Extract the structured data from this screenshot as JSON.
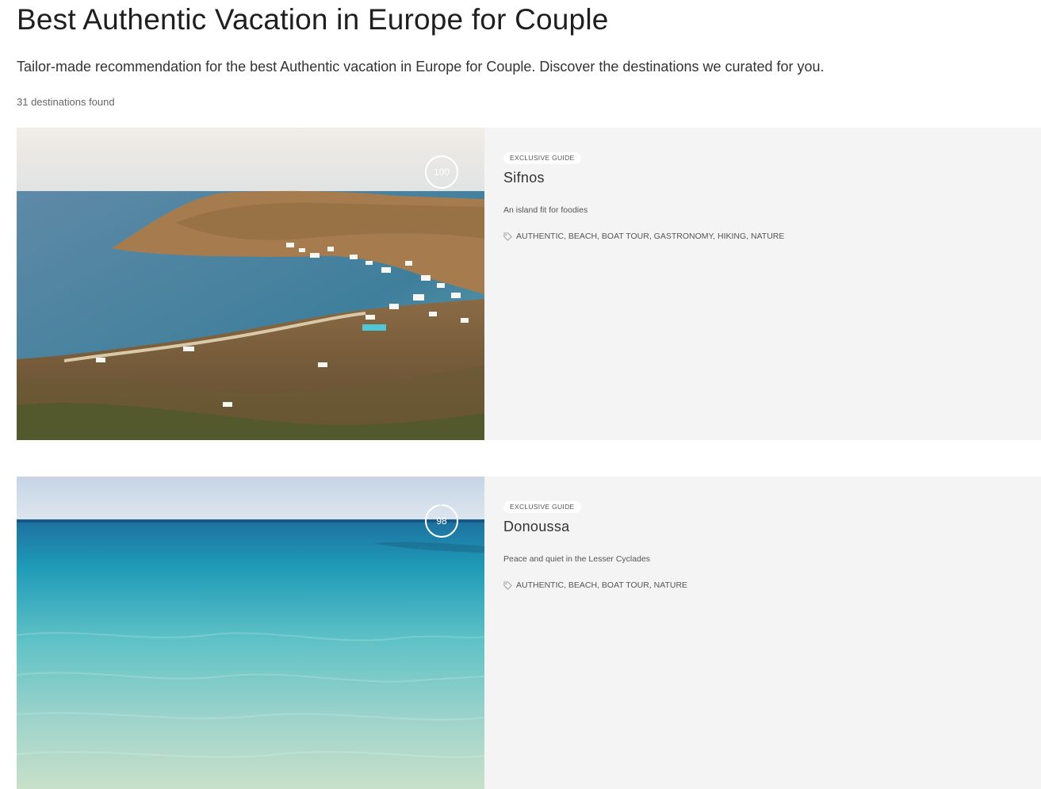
{
  "page": {
    "title": "Best Authentic Vacation in Europe for Couple",
    "intro": "Tailor-made recommendation for the best Authentic vacation in Europe for Couple. Discover the destinations we curated for you.",
    "results_count": "31 destinations found"
  },
  "destinations": [
    {
      "badge": "EXCLUSIVE GUIDE",
      "name": "Sifnos",
      "tagline": "An island fit for foodies",
      "tags": "AUTHENTIC, BEACH, BOAT TOUR, GASTRONOMY, HIKING, NATURE",
      "score": "100",
      "score_fraction": 1.0,
      "photo_icon": "bay-landscape-photo"
    },
    {
      "badge": "EXCLUSIVE GUIDE",
      "name": "Donoussa",
      "tagline": "Peace and quiet in the Lesser Cyclades",
      "tags": "AUTHENTIC, BEACH, BOAT TOUR, NATURE",
      "score": "98",
      "score_fraction": 0.98,
      "photo_icon": "sea-water-photo"
    }
  ],
  "colors": {
    "card_background": "#f4f4f4",
    "score_ring": "#ffffff"
  }
}
